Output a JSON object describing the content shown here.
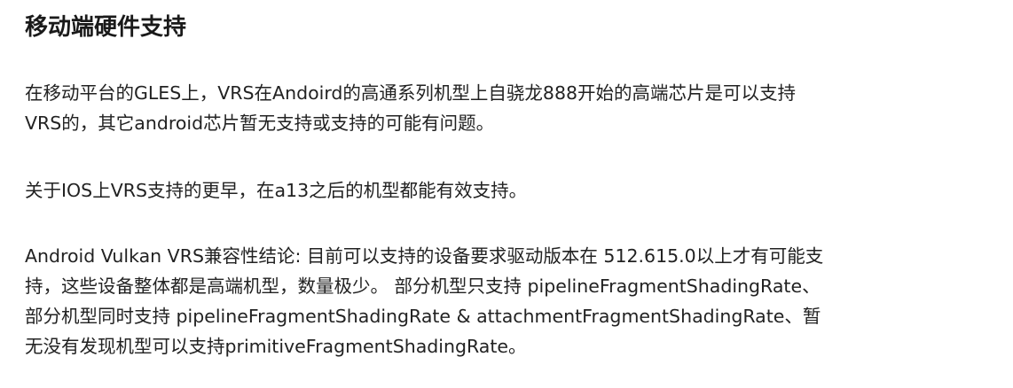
{
  "article": {
    "heading": "移动端硬件支持",
    "paragraphs": [
      {
        "lines": [
          "在移动平台的GLES上，VRS在Andoird的高通系列机型上自骁龙888开始的高端芯片是可以支持",
          "VRS的，其它android芯片暂无支持或支持的可能有问题。"
        ]
      },
      {
        "lines": [
          "关于IOS上VRS支持的更早，在a13之后的机型都能有效支持。"
        ]
      },
      {
        "lines": [
          "Android Vulkan VRS兼容性结论: 目前可以支持的设备要求驱动版本在 512.615.0以上才有可能支",
          "持，这些设备整体都是高端机型，数量极少。 部分机型只支持 pipelineFragmentShadingRate、",
          "部分机型同时支持 pipelineFragmentShadingRate & attachmentFragmentShadingRate、暂",
          "无没有发现机型可以支持primitiveFragmentShadingRate。"
        ]
      }
    ]
  }
}
